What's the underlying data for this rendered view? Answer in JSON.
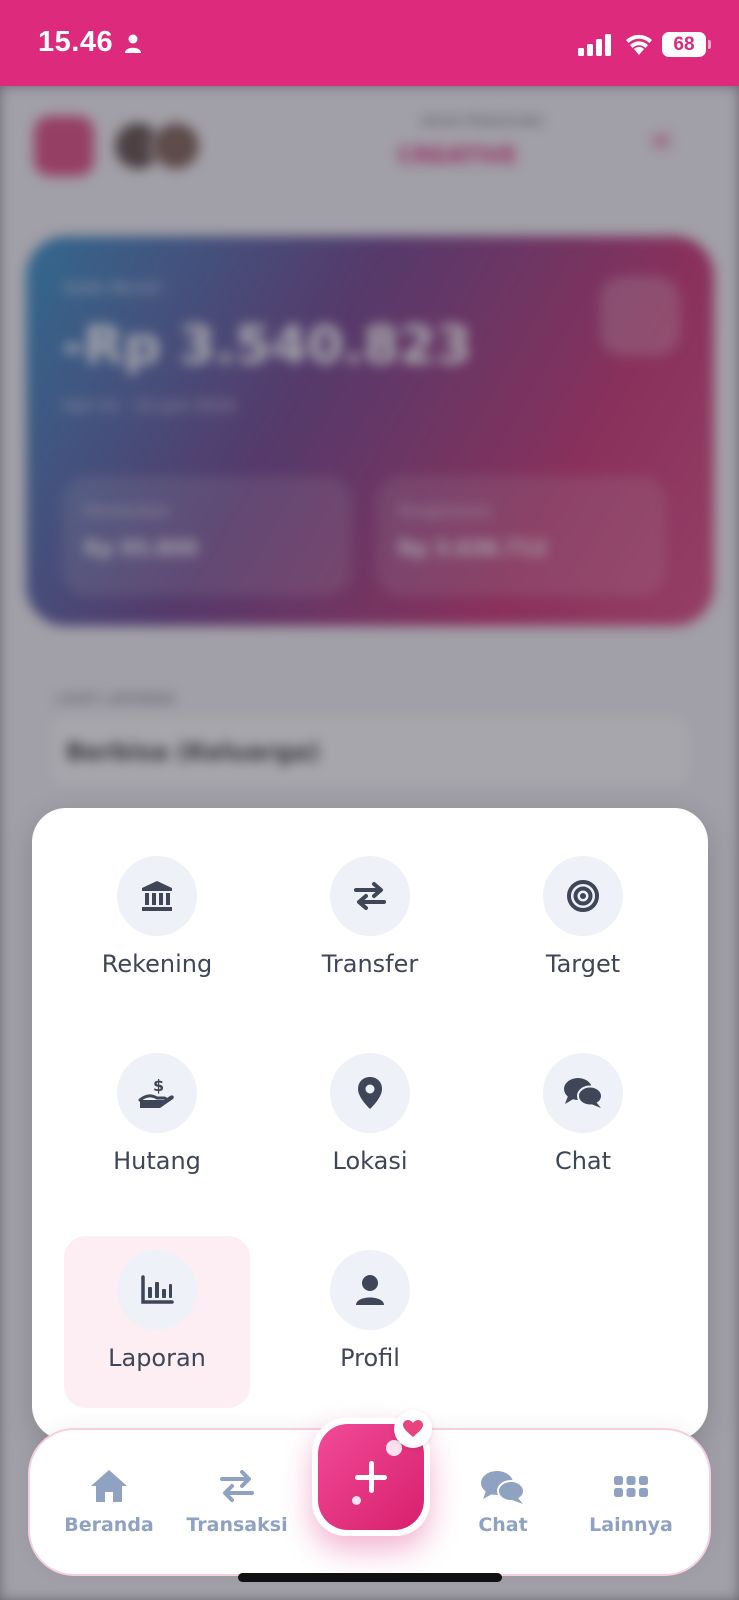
{
  "status_bar": {
    "time": "15.46",
    "battery": "68",
    "background": "#de2a7c"
  },
  "background_app": {
    "account_label_small": "AKUN PENGGUNA",
    "account_name": "CREATIVE",
    "card": {
      "label": "Saldo Bersih",
      "amount": "-Rp 3.540.823",
      "date": "Hari ini · 15 Juni 2024",
      "income_label": "Pemasukan",
      "income_value": "Rp 95.800",
      "expense_label": "Pengeluaran",
      "expense_value": "Rp 3.636.712"
    },
    "report_label": "LIHAT LAPORAN",
    "report_select": "Berbisa (Keluarga)"
  },
  "menu": {
    "items": [
      {
        "label": "Rekening",
        "icon": "bank-icon"
      },
      {
        "label": "Transfer",
        "icon": "transfer-arrows-icon"
      },
      {
        "label": "Target",
        "icon": "target-icon"
      },
      {
        "label": "Hutang",
        "icon": "hand-dollar-icon"
      },
      {
        "label": "Lokasi",
        "icon": "location-pin-icon"
      },
      {
        "label": "Chat",
        "icon": "chat-bubbles-icon"
      },
      {
        "label": "Laporan",
        "icon": "bar-chart-icon",
        "active": true
      },
      {
        "label": "Profil",
        "icon": "user-icon"
      }
    ]
  },
  "bottom_nav": {
    "items": [
      {
        "label": "Beranda",
        "icon": "home-icon"
      },
      {
        "label": "Transaksi",
        "icon": "transfer-arrows-icon"
      },
      {
        "label": "Chat",
        "icon": "chat-bubbles-icon"
      },
      {
        "label": "Lainnya",
        "icon": "grid-icon"
      }
    ],
    "fab_icon": "plus-icon"
  },
  "colors": {
    "accent": "#de2a7c",
    "icon_dark": "#3e4658",
    "icon_circle": "#eef1f7",
    "nav_inactive": "#8fa2c2",
    "active_item_bg": "#fdeef4"
  }
}
